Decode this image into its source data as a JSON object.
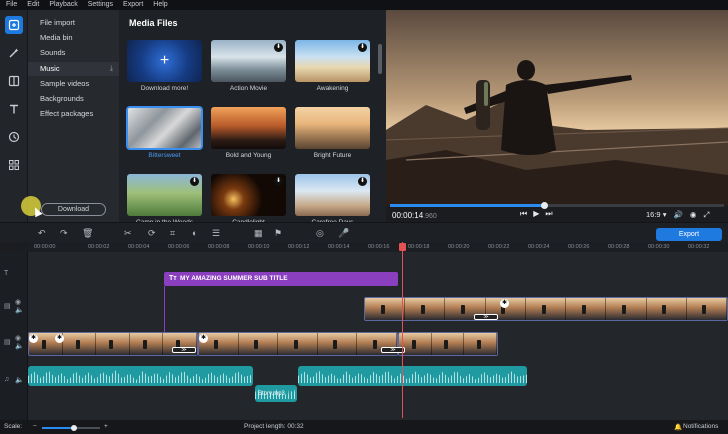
{
  "menu": [
    "File",
    "Edit",
    "Playback",
    "Settings",
    "Export",
    "Help"
  ],
  "sidebar": {
    "items": [
      {
        "label": "File import",
        "download": false
      },
      {
        "label": "Media bin",
        "download": false
      },
      {
        "label": "Sounds",
        "download": false
      },
      {
        "label": "Music",
        "download": true
      },
      {
        "label": "Sample videos",
        "download": false
      },
      {
        "label": "Backgrounds",
        "download": false
      },
      {
        "label": "Effect packages",
        "download": false
      }
    ],
    "selected": "Music",
    "download_button": "Download"
  },
  "media": {
    "title": "Media Files",
    "tiles": [
      {
        "label": "Download more!",
        "icon": "plus-icon"
      },
      {
        "label": "Action Movie",
        "icon": "download-icon"
      },
      {
        "label": "Awakening",
        "icon": "download-icon"
      },
      {
        "label": "Bittersweet",
        "selected": true
      },
      {
        "label": "Bold and Young"
      },
      {
        "label": "Bright Future"
      },
      {
        "label": "Camp in the Woods",
        "icon": "download-icon"
      },
      {
        "label": "Candlelight",
        "icon": "download-icon"
      },
      {
        "label": "Carefree Days",
        "icon": "download-icon"
      }
    ]
  },
  "preview": {
    "timecode": "00:00:14",
    "timecode_frames": ".960",
    "aspect": "16:9",
    "progress": 0.46
  },
  "toolbar": {
    "export_label": "Export"
  },
  "ruler": [
    "00:00:00",
    "00:00:02",
    "00:00:04",
    "00:00:06",
    "00:00:08",
    "00:00:10",
    "00:00:12",
    "00:00:14",
    "00:00:16",
    "00:00:18",
    "00:00:20",
    "00:00:22",
    "00:00:24",
    "00:00:26",
    "00:00:28",
    "00:00:30",
    "00:00:32"
  ],
  "timeline": {
    "title_clip": "MY AMAZING SUMMER SUB TITLE",
    "audio_label": "Story.mp3"
  },
  "bottom": {
    "scale_label": "Scale:",
    "project_length": "Project length: 00:32",
    "notifications": "Notifications",
    "zoom": 0.56
  },
  "colors": {
    "accent": "#1f7ae0",
    "title_clip": "#8a3fbf",
    "audio_clip": "#1f9aa0",
    "playhead": "#e25252"
  }
}
